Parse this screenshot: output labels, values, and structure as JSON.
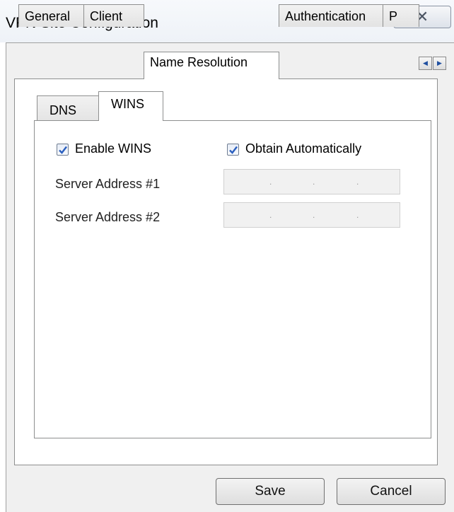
{
  "window": {
    "title": "VPN Site Configuration",
    "close_icon": "close-icon"
  },
  "outer_tabs": [
    {
      "label": "General",
      "active": false
    },
    {
      "label": "Client",
      "active": false
    },
    {
      "label": "Name Resolution",
      "active": true
    },
    {
      "label": "Authentication",
      "active": false
    },
    {
      "label": "P",
      "active": false
    }
  ],
  "inner_tabs": [
    {
      "label": "DNS",
      "active": false
    },
    {
      "label": "WINS",
      "active": true
    }
  ],
  "wins": {
    "enable_wins": {
      "label": "Enable WINS",
      "checked": true
    },
    "obtain_automatically": {
      "label": "Obtain Automatically",
      "checked": true
    },
    "server1": {
      "label": "Server Address #1",
      "value": ""
    },
    "server2": {
      "label": "Server Address #2",
      "value": ""
    }
  },
  "buttons": {
    "save": "Save",
    "cancel": "Cancel"
  },
  "colors": {
    "check_mark": "#2a5fbf",
    "disabled_field": "#f1f1f1",
    "panel_bg": "#f0f0f0"
  }
}
